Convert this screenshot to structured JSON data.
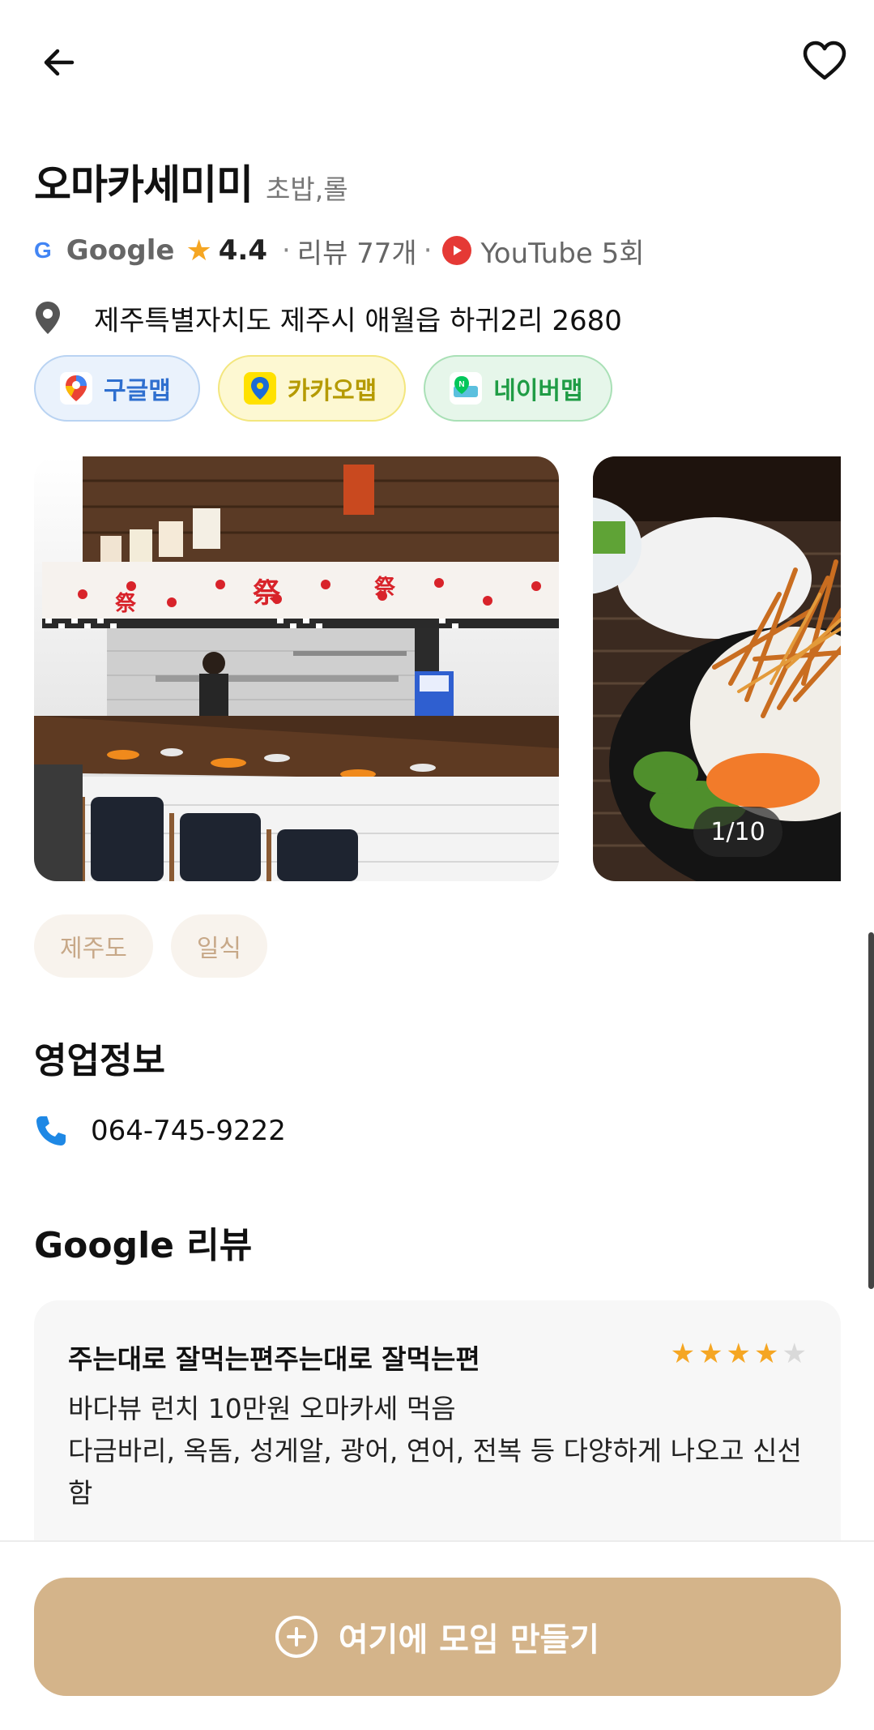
{
  "restaurant": {
    "name": "오마카세미미",
    "category": "초밥,롤"
  },
  "rating": {
    "source": "Google",
    "score": "4.4",
    "separator": "·",
    "review_count": "리뷰 77개",
    "youtube": "YouTube 5회"
  },
  "address": "제주특별자치도 제주시 애월읍 하귀2리 2680",
  "maps": {
    "google": "구글맵",
    "kakao": "카카오맵",
    "naver": "네이버맵"
  },
  "gallery": {
    "counter": "1/10"
  },
  "tags": [
    "제주도",
    "일식"
  ],
  "business_info": {
    "title": "영업정보",
    "phone": "064-745-9222"
  },
  "reviews": {
    "title": "Google 리뷰",
    "items": [
      {
        "author": "주는대로 잘먹는편주는대로 잘먹는편",
        "stars": 4,
        "max_stars": 5,
        "text": "바다뷰 런치 10만원 오마카세 먹음\n다금바리, 옥돔, 성게알, 광어, 연어, 전복 등 다양하게 나오고 신선함"
      }
    ]
  },
  "cta": {
    "label": "여기에 모임 만들기"
  },
  "colors": {
    "accent": "#d4b48a",
    "star": "#f5a623",
    "youtube": "#e53935"
  }
}
